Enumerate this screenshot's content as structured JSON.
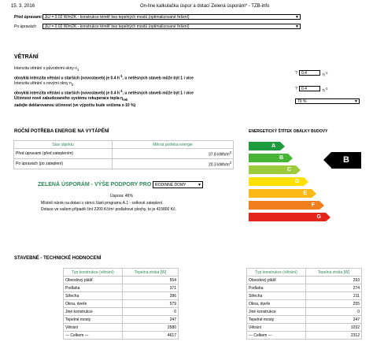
{
  "header": {
    "date": "15. 3. 2016",
    "title": "On-line kalkulačka úspor a dotací Zelená úsporám* - TZB-info"
  },
  "before": {
    "label": "Před úpravami",
    "value": "ΔU = 0.02 W/m2K - konstrukce téměř bez tepelných mostů (optimalizované řešení)"
  },
  "after": {
    "label": "Po úpravách",
    "value": "ΔU = 0.02 W/m2K - konstrukce téměř bez tepelných mostů (optimalizované řešení)"
  },
  "ventilation": {
    "heading": "VĚTRÁNÍ",
    "orig_label1": "Intenzita větrání s původními okny n",
    "orig_label1_sub": "1",
    "orig_label2": "obvyklá intenzita větrání u starších (novostaveb) je 0.4 h",
    "orig_label2_sup": "-1",
    "orig_label2_tail": ", u netěsných staveb může být 1 i více",
    "orig_q": "?",
    "orig_value": "0.4",
    "orig_unit": "h",
    "orig_unit_sup": "-1",
    "new_label1": "Intenzita větrání s novými okny n",
    "new_label1_sub": "2",
    "new_label2": "obvyklá intenzita větrání u starších (novostaveb) je 0.4 h",
    "new_label2_sup": "-1",
    "new_label2_tail": ", u netěsných staveb může být 1 i více",
    "new_q": "?",
    "new_value": "0.4",
    "new_unit": "h",
    "new_unit_sup": "-1",
    "rec_label1": "Účinnost nově zabudovaného systému rekuperace tepla η",
    "rec_label1_sub": "rek",
    "rec_label2": "zadejte deklarovanou účinnost (ve výpočtu bude snížena o 10 %)",
    "rec_value": "70 %"
  },
  "energy_need": {
    "heading": "ROČNÍ POTŘEBA ENERGIE NA VYTÁPĚNÍ",
    "col_state": "Stav objektu",
    "col_need": "Měrná potřeba energie",
    "rows": [
      {
        "state": "Před úpravami  (před zateplením)",
        "value": "37.8 kWh/m",
        "sup": "2"
      },
      {
        "state": "Po úpravách  (po zateplení)",
        "value": "20.3 kWh/m",
        "sup": "2"
      }
    ]
  },
  "label_title": "ENERGETICKÝ ŠTÍTEK OBÁLKY BUDOVY",
  "classes": [
    "A",
    "B",
    "C",
    "D",
    "E",
    "F",
    "G"
  ],
  "active_class": "B",
  "support": {
    "heading": "ZELENÁ ÚSPORÁM - VÝŠE PODPORY PRO",
    "select_value": "RODINNÉ DOMY",
    "saving": "Úspora: 46%",
    "line2": "Místně nárok na dotaci v rámci části programu A.1 - celkové zateplení.",
    "line3": "Dotace ve vašem případě činí 2200 Kč/m² podlahové plochy, to je 415800 Kč."
  },
  "technical": {
    "heading": "STAVEBNÉ - TECHNICKÉ HODNOCENÍ",
    "col_type": "Typ konstrukce (větrání)",
    "col_loss": "Tepelná ztráta [W]",
    "left_rows": [
      {
        "name": "Obvodový plášť",
        "value": "554"
      },
      {
        "name": "Podlaha",
        "value": "371"
      },
      {
        "name": "Střecha",
        "value": "286"
      },
      {
        "name": "Okna, dveře",
        "value": "579"
      },
      {
        "name": "Jiné konstrukce",
        "value": "0"
      },
      {
        "name": "Tepelné mosty",
        "value": "247"
      },
      {
        "name": "Větrání",
        "value": "2580"
      },
      {
        "name": "--- Celkem ---",
        "value": "4617"
      }
    ],
    "right_rows": [
      {
        "name": "Obvodový plášť",
        "value": "293"
      },
      {
        "name": "Podlaha",
        "value": "274"
      },
      {
        "name": "Střecha",
        "value": "211"
      },
      {
        "name": "Okna, dveře",
        "value": "255"
      },
      {
        "name": "Jiné konstrukce",
        "value": "0"
      },
      {
        "name": "Tepelné mosty",
        "value": "247"
      },
      {
        "name": "Větrání",
        "value": "1032"
      },
      {
        "name": "--- Celkem ---",
        "value": "2312"
      }
    ]
  },
  "colors": {
    "A": "#1e9b3c",
    "B": "#46b435",
    "C": "#9ccb3b",
    "D": "#ffe000",
    "E": "#fbb817",
    "F": "#f07d1e",
    "G": "#e3261b",
    "accent": "#2e8b57"
  }
}
